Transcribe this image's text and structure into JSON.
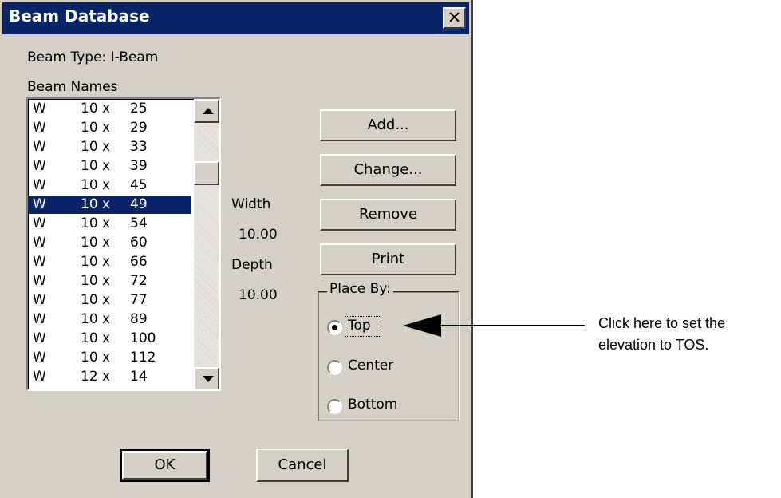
{
  "window": {
    "title": "Beam Database",
    "close_glyph": "✕"
  },
  "beam_type_label": "Beam Type: I-Beam",
  "beam_names_label": "Beam Names",
  "beam_list": [
    {
      "shape": "W",
      "size": "10 x",
      "weight": "25",
      "selected": false
    },
    {
      "shape": "W",
      "size": "10 x",
      "weight": "29",
      "selected": false
    },
    {
      "shape": "W",
      "size": "10 x",
      "weight": "33",
      "selected": false
    },
    {
      "shape": "W",
      "size": "10 x",
      "weight": "39",
      "selected": false
    },
    {
      "shape": "W",
      "size": "10 x",
      "weight": "45",
      "selected": false
    },
    {
      "shape": "W",
      "size": "10 x",
      "weight": "49",
      "selected": true
    },
    {
      "shape": "W",
      "size": "10 x",
      "weight": "54",
      "selected": false
    },
    {
      "shape": "W",
      "size": "10 x",
      "weight": "60",
      "selected": false
    },
    {
      "shape": "W",
      "size": "10 x",
      "weight": "66",
      "selected": false
    },
    {
      "shape": "W",
      "size": "10 x",
      "weight": "72",
      "selected": false
    },
    {
      "shape": "W",
      "size": "10 x",
      "weight": "77",
      "selected": false
    },
    {
      "shape": "W",
      "size": "10 x",
      "weight": "89",
      "selected": false
    },
    {
      "shape": "W",
      "size": "10 x",
      "weight": "100",
      "selected": false
    },
    {
      "shape": "W",
      "size": "10 x",
      "weight": "112",
      "selected": false
    },
    {
      "shape": "W",
      "size": "12 x",
      "weight": "14",
      "selected": false
    }
  ],
  "dimensions": {
    "width_label": "Width",
    "width_value": "10.00",
    "depth_label": "Depth",
    "depth_value": "10.00"
  },
  "buttons": {
    "add": "Add...",
    "change": "Change...",
    "remove": "Remove",
    "print": "Print",
    "ok": "OK",
    "cancel": "Cancel"
  },
  "place_by": {
    "legend": "Place By:",
    "options": [
      {
        "label": "Top",
        "checked": true
      },
      {
        "label": "Center",
        "checked": false
      },
      {
        "label": "Bottom",
        "checked": false
      }
    ]
  },
  "annotation": {
    "line1": "Click here to set the",
    "line2": "elevation to TOS."
  },
  "colors": {
    "dialog_bg": "#d4d0c8",
    "titlebar": "#0a246a",
    "selection": "#0a246a"
  }
}
